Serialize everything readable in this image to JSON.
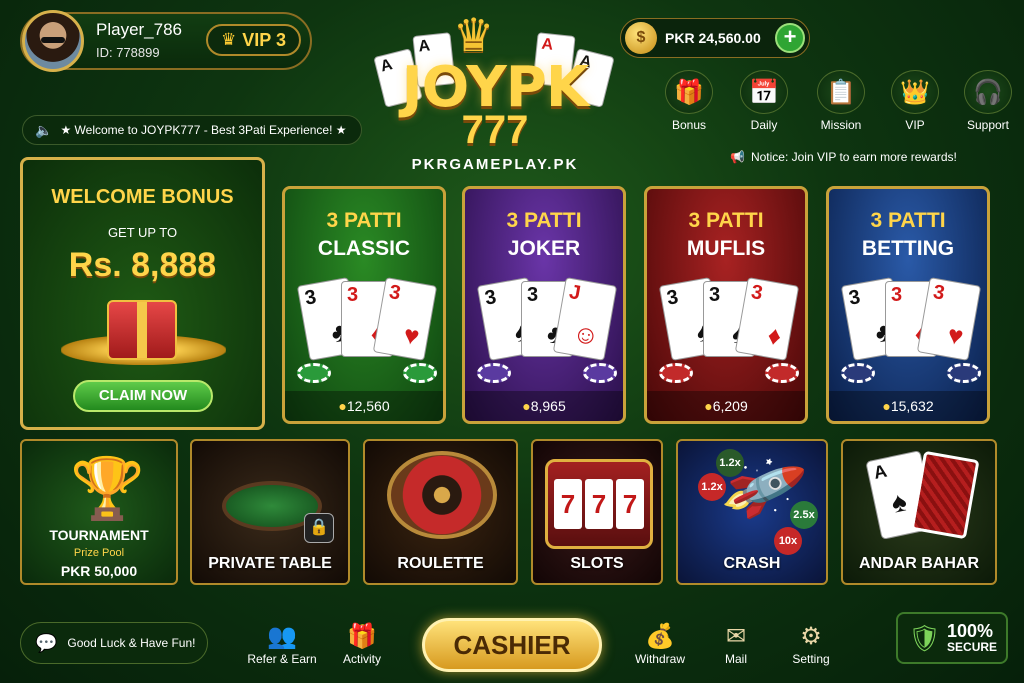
{
  "player": {
    "name": "Player_786",
    "id": "ID: 778899",
    "vip": "VIP 3"
  },
  "marquee": "★ Welcome to JOYPK777 - Best 3Pati Experience! ★",
  "logo": {
    "main": "JOYPK",
    "num": "777",
    "sub": "PKRGAMEPLAY.PK"
  },
  "balance": {
    "amount": "PKR 24,560.00",
    "plus": "+"
  },
  "top_menu": [
    {
      "label": "Bonus",
      "icon": "gift-icon",
      "glyph": "🎁"
    },
    {
      "label": "Daily",
      "icon": "calendar-check-icon",
      "glyph": "📅"
    },
    {
      "label": "Mission",
      "icon": "clipboard-icon",
      "glyph": "📋"
    },
    {
      "label": "VIP",
      "icon": "crown-icon",
      "glyph": "👑"
    },
    {
      "label": "Support",
      "icon": "headset-icon",
      "glyph": "🎧"
    }
  ],
  "notice": "Notice: Join VIP to earn more rewards!",
  "bonus": {
    "title": "WELCOME BONUS",
    "sub": "GET UP TO",
    "amount": "Rs. 8,888",
    "button": "CLAIM NOW"
  },
  "games": [
    {
      "l1": "3 PATTI",
      "l2": "CLASSIC",
      "count": "12,560",
      "bg": "#1b6a1a"
    },
    {
      "l1": "3 PATTI",
      "l2": "JOKER",
      "count": "8,965",
      "bg": "#4a1f7a"
    },
    {
      "l1": "3 PATTI",
      "l2": "MUFLIS",
      "count": "6,209",
      "bg": "#7a1414"
    },
    {
      "l1": "3 PATTI",
      "l2": "BETTING",
      "count": "15,632",
      "bg": "#163e7a"
    }
  ],
  "small_games": {
    "tournament": {
      "label": "TOURNAMENT",
      "pool": "Prize Pool",
      "amount": "PKR 50,000"
    },
    "private": "PRIVATE TABLE",
    "roulette": "ROULETTE",
    "slots": "SLOTS",
    "crash": "CRASH",
    "andar": "ANDAR BAHAR"
  },
  "crash_mults": [
    "1.2x",
    "1.2x",
    "2.5x",
    "10x"
  ],
  "slot_reels": [
    "7",
    "7",
    "7"
  ],
  "bottom": {
    "luck": "Good Luck & Have Fun!",
    "refer": "Refer & Earn",
    "activity": "Activity",
    "cashier": "CASHIER",
    "withdraw": "Withdraw",
    "mail": "Mail",
    "setting": "Setting",
    "secure_big": "100%",
    "secure_small": "SECURE"
  }
}
